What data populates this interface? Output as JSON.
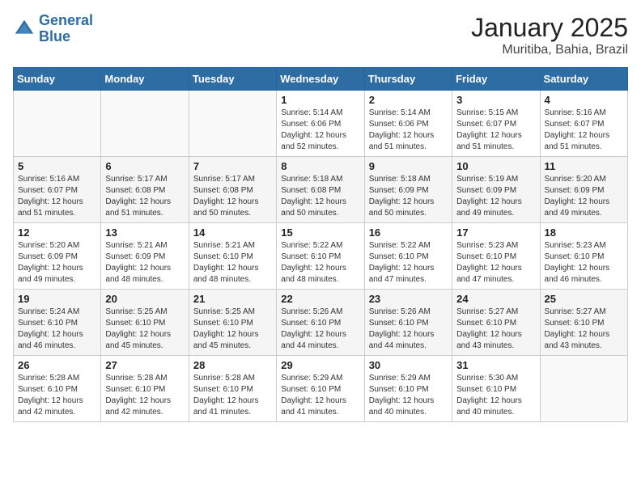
{
  "header": {
    "logo_general": "General",
    "logo_blue": "Blue",
    "month_year": "January 2025",
    "location": "Muritiba, Bahia, Brazil"
  },
  "days_of_week": [
    "Sunday",
    "Monday",
    "Tuesday",
    "Wednesday",
    "Thursday",
    "Friday",
    "Saturday"
  ],
  "weeks": [
    [
      {
        "num": "",
        "info": ""
      },
      {
        "num": "",
        "info": ""
      },
      {
        "num": "",
        "info": ""
      },
      {
        "num": "1",
        "info": "Sunrise: 5:14 AM\nSunset: 6:06 PM\nDaylight: 12 hours\nand 52 minutes."
      },
      {
        "num": "2",
        "info": "Sunrise: 5:14 AM\nSunset: 6:06 PM\nDaylight: 12 hours\nand 51 minutes."
      },
      {
        "num": "3",
        "info": "Sunrise: 5:15 AM\nSunset: 6:07 PM\nDaylight: 12 hours\nand 51 minutes."
      },
      {
        "num": "4",
        "info": "Sunrise: 5:16 AM\nSunset: 6:07 PM\nDaylight: 12 hours\nand 51 minutes."
      }
    ],
    [
      {
        "num": "5",
        "info": "Sunrise: 5:16 AM\nSunset: 6:07 PM\nDaylight: 12 hours\nand 51 minutes."
      },
      {
        "num": "6",
        "info": "Sunrise: 5:17 AM\nSunset: 6:08 PM\nDaylight: 12 hours\nand 51 minutes."
      },
      {
        "num": "7",
        "info": "Sunrise: 5:17 AM\nSunset: 6:08 PM\nDaylight: 12 hours\nand 50 minutes."
      },
      {
        "num": "8",
        "info": "Sunrise: 5:18 AM\nSunset: 6:08 PM\nDaylight: 12 hours\nand 50 minutes."
      },
      {
        "num": "9",
        "info": "Sunrise: 5:18 AM\nSunset: 6:09 PM\nDaylight: 12 hours\nand 50 minutes."
      },
      {
        "num": "10",
        "info": "Sunrise: 5:19 AM\nSunset: 6:09 PM\nDaylight: 12 hours\nand 49 minutes."
      },
      {
        "num": "11",
        "info": "Sunrise: 5:20 AM\nSunset: 6:09 PM\nDaylight: 12 hours\nand 49 minutes."
      }
    ],
    [
      {
        "num": "12",
        "info": "Sunrise: 5:20 AM\nSunset: 6:09 PM\nDaylight: 12 hours\nand 49 minutes."
      },
      {
        "num": "13",
        "info": "Sunrise: 5:21 AM\nSunset: 6:09 PM\nDaylight: 12 hours\nand 48 minutes."
      },
      {
        "num": "14",
        "info": "Sunrise: 5:21 AM\nSunset: 6:10 PM\nDaylight: 12 hours\nand 48 minutes."
      },
      {
        "num": "15",
        "info": "Sunrise: 5:22 AM\nSunset: 6:10 PM\nDaylight: 12 hours\nand 48 minutes."
      },
      {
        "num": "16",
        "info": "Sunrise: 5:22 AM\nSunset: 6:10 PM\nDaylight: 12 hours\nand 47 minutes."
      },
      {
        "num": "17",
        "info": "Sunrise: 5:23 AM\nSunset: 6:10 PM\nDaylight: 12 hours\nand 47 minutes."
      },
      {
        "num": "18",
        "info": "Sunrise: 5:23 AM\nSunset: 6:10 PM\nDaylight: 12 hours\nand 46 minutes."
      }
    ],
    [
      {
        "num": "19",
        "info": "Sunrise: 5:24 AM\nSunset: 6:10 PM\nDaylight: 12 hours\nand 46 minutes."
      },
      {
        "num": "20",
        "info": "Sunrise: 5:25 AM\nSunset: 6:10 PM\nDaylight: 12 hours\nand 45 minutes."
      },
      {
        "num": "21",
        "info": "Sunrise: 5:25 AM\nSunset: 6:10 PM\nDaylight: 12 hours\nand 45 minutes."
      },
      {
        "num": "22",
        "info": "Sunrise: 5:26 AM\nSunset: 6:10 PM\nDaylight: 12 hours\nand 44 minutes."
      },
      {
        "num": "23",
        "info": "Sunrise: 5:26 AM\nSunset: 6:10 PM\nDaylight: 12 hours\nand 44 minutes."
      },
      {
        "num": "24",
        "info": "Sunrise: 5:27 AM\nSunset: 6:10 PM\nDaylight: 12 hours\nand 43 minutes."
      },
      {
        "num": "25",
        "info": "Sunrise: 5:27 AM\nSunset: 6:10 PM\nDaylight: 12 hours\nand 43 minutes."
      }
    ],
    [
      {
        "num": "26",
        "info": "Sunrise: 5:28 AM\nSunset: 6:10 PM\nDaylight: 12 hours\nand 42 minutes."
      },
      {
        "num": "27",
        "info": "Sunrise: 5:28 AM\nSunset: 6:10 PM\nDaylight: 12 hours\nand 42 minutes."
      },
      {
        "num": "28",
        "info": "Sunrise: 5:28 AM\nSunset: 6:10 PM\nDaylight: 12 hours\nand 41 minutes."
      },
      {
        "num": "29",
        "info": "Sunrise: 5:29 AM\nSunset: 6:10 PM\nDaylight: 12 hours\nand 41 minutes."
      },
      {
        "num": "30",
        "info": "Sunrise: 5:29 AM\nSunset: 6:10 PM\nDaylight: 12 hours\nand 40 minutes."
      },
      {
        "num": "31",
        "info": "Sunrise: 5:30 AM\nSunset: 6:10 PM\nDaylight: 12 hours\nand 40 minutes."
      },
      {
        "num": "",
        "info": ""
      }
    ]
  ]
}
